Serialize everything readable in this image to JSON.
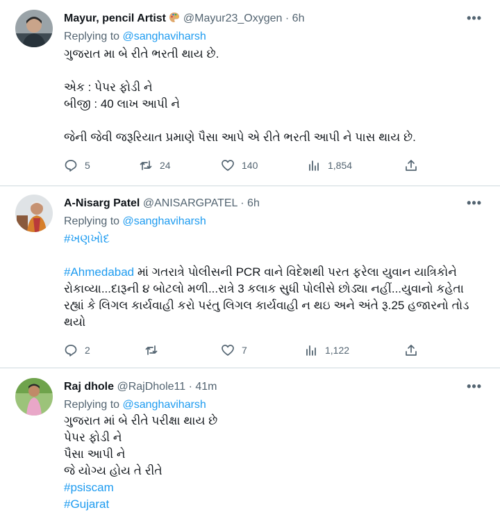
{
  "tweets": [
    {
      "name": "Mayur, pencil Artist",
      "handle": "@Mayur23_Oxygen",
      "separator": "·",
      "time": "6h",
      "replying_prefix": "Replying to ",
      "replying_to": "@sanghaviharsh",
      "lines": [
        "ગુજરાત મા બે રીતે ભરતી થાય છે.",
        "",
        "એક : પેપર ફોડી ને",
        "બીજી : 40 લાખ આપી ને",
        "",
        "જેની જેવી જરૂરિયાત પ્રમાણે પૈસા આપે એ રીતે ભરતી આપી ને પાસ થાય છે."
      ],
      "stats": {
        "replies": "5",
        "retweets": "24",
        "likes": "140",
        "views": "1,854"
      }
    },
    {
      "name": "A-Nisarg Patel",
      "handle": "@ANISARGPATEL",
      "separator": "·",
      "time": "6h",
      "replying_prefix": "Replying to ",
      "replying_to": "@sanghaviharsh",
      "hashtag_top": "#ખણખોદ",
      "body_hashtag": "#Ahmedabad",
      "body_lines": [
        " માં ગતરાત્રે પોલીસની PCR વાને વિદેશથી પરત ફરેલા યુવાન યાત્રિકોને",
        "રોકાવ્યા...દારૂની ૪ બોટલો મળી...રાત્રે 3 કલાક સુધી પોલીસે છોડ્યા નહીં...યુવાનો કહેતા",
        "રહ્યાં કે લિગલ કાર્યવાહી કરો પરંતુ લિગલ કાર્યવાહી ન થઇ અને અંતે રૂ.25 હજારનો તોડ",
        "થયો"
      ],
      "stats": {
        "replies": "2",
        "retweets": "",
        "likes": "7",
        "views": "1,122"
      }
    },
    {
      "name": "Raj dhole",
      "handle": "@RajDhole11",
      "separator": "·",
      "time": "41m",
      "replying_prefix": "Replying to ",
      "replying_to": "@sanghaviharsh",
      "lines": [
        "ગુજરાત માં બે રીતે પરીક્ષા થાય છે",
        "પેપર ફોડી ને",
        "પૈસા આપી ને",
        "જે યોગ્ય હોય તે રીતે"
      ],
      "hashtags": [
        "#psiscam",
        "#Gujarat"
      ],
      "stats": {
        "replies": "",
        "retweets": "",
        "likes": "",
        "views": ""
      }
    }
  ],
  "icons": {
    "more": "more-icon",
    "reply": "reply-icon",
    "retweet": "retweet-icon",
    "like": "like-icon",
    "views": "views-icon",
    "share": "share-icon"
  },
  "colors": {
    "link": "#1d9bf0",
    "muted": "#536471",
    "text": "#0f1419",
    "divider": "#cfd9de"
  }
}
